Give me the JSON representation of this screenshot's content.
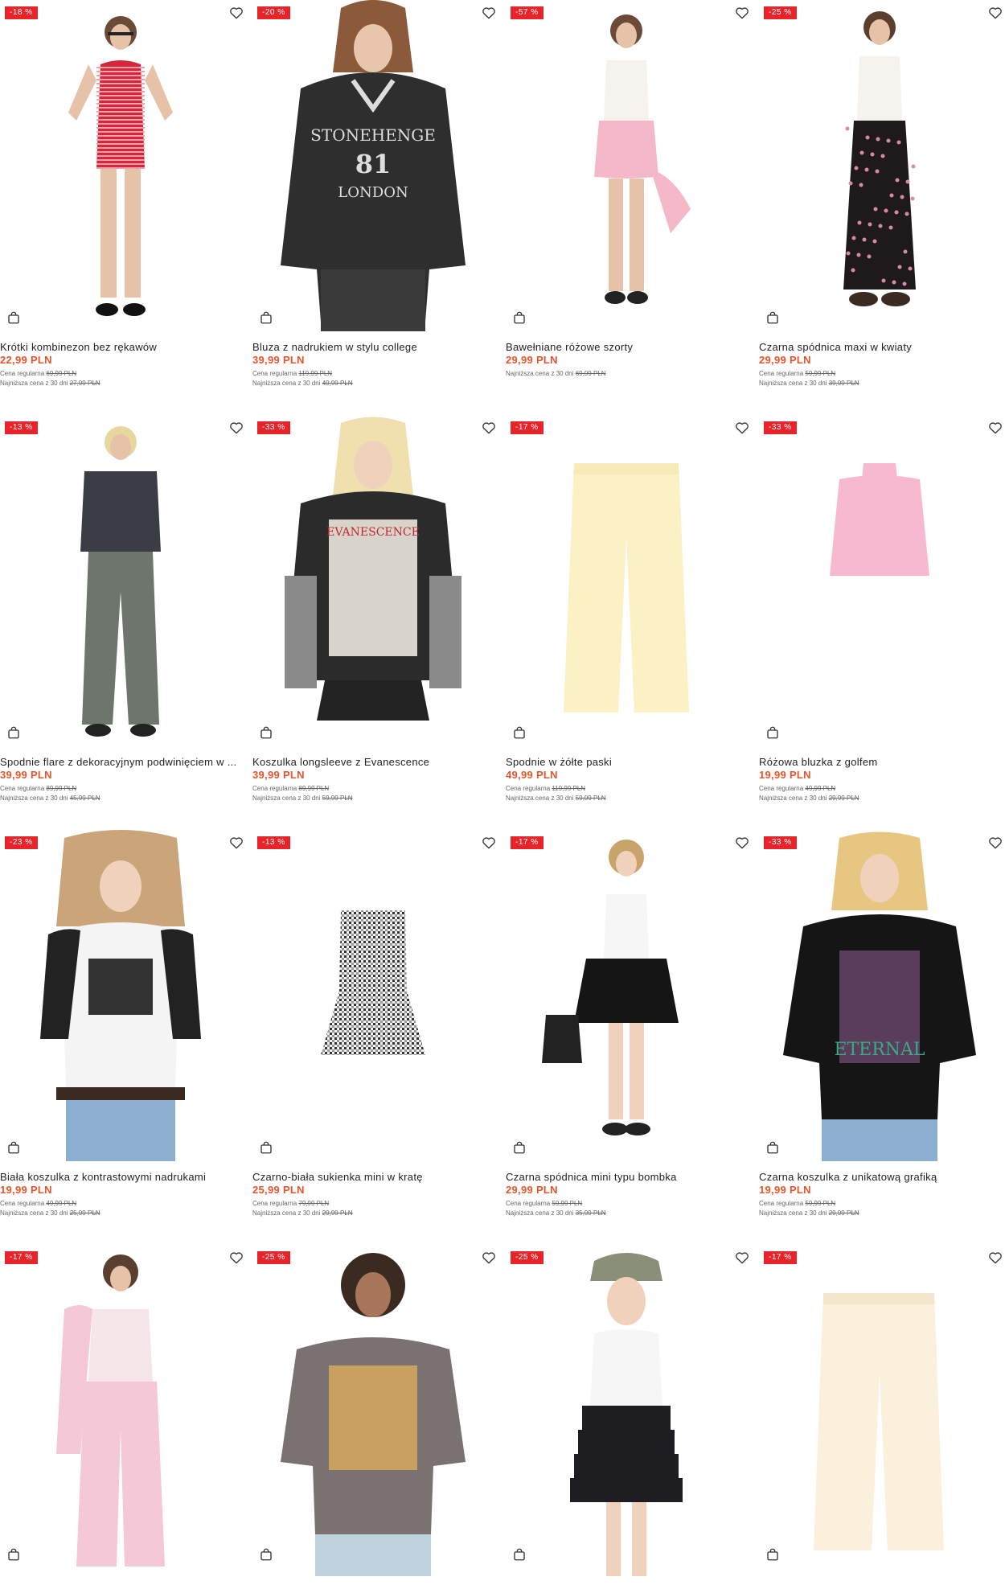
{
  "colors": {
    "discount_badge": "#e8242b",
    "sale_price": "#e8542b"
  },
  "icons": {
    "wishlist": "heart-icon",
    "cart": "shopping-bag-icon"
  },
  "products": [
    {
      "badge": "-18 %",
      "title": "Krótki kombinezon bez rękawów",
      "price": "22,99 PLN",
      "reg_label": "Cena regularna",
      "reg_price": "69,99 PLN",
      "low_label": "Najniższa cena z 30 dni",
      "low_price": "27,99 PLN"
    },
    {
      "badge": "-20 %",
      "title": "Bluza z nadrukiem w stylu college",
      "price": "39,99 PLN",
      "reg_label": "Cena regularna",
      "reg_price": "119,99 PLN",
      "low_label": "Najniższa cena z 30 dni",
      "low_price": "49,99 PLN"
    },
    {
      "badge": "-57 %",
      "title": "Bawełniane różowe szorty",
      "price": "29,99 PLN",
      "reg_label": "",
      "reg_price": "",
      "low_label": "Najniższa cena z 30 dni",
      "low_price": "69,99 PLN"
    },
    {
      "badge": "-25 %",
      "title": "Czarna spódnica maxi w kwiaty",
      "price": "29,99 PLN",
      "reg_label": "Cena regularna",
      "reg_price": "59,99 PLN",
      "low_label": "Najniższa cena z 30 dni",
      "low_price": "39,99 PLN"
    },
    {
      "badge": "-13 %",
      "title": "Spodnie flare z dekoracyjnym podwinięciem w ...",
      "price": "39,99 PLN",
      "reg_label": "Cena regularna",
      "reg_price": "89,99 PLN",
      "low_label": "Najniższa cena z 30 dni",
      "low_price": "45,99 PLN"
    },
    {
      "badge": "-33 %",
      "title": "Koszulka longsleeve z Evanescence",
      "price": "39,99 PLN",
      "reg_label": "Cena regularna",
      "reg_price": "89,99 PLN",
      "low_label": "Najniższa cena z 30 dni",
      "low_price": "59,99 PLN"
    },
    {
      "badge": "-17 %",
      "title": "Spodnie w żółte paski",
      "price": "49,99 PLN",
      "reg_label": "Cena regularna",
      "reg_price": "119,99 PLN",
      "low_label": "Najniższa cena z 30 dni",
      "low_price": "59,99 PLN"
    },
    {
      "badge": "-33 %",
      "title": "Różowa bluzka z golfem",
      "price": "19,99 PLN",
      "reg_label": "Cena regularna",
      "reg_price": "49,99 PLN",
      "low_label": "Najniższa cena z 30 dni",
      "low_price": "29,99 PLN"
    },
    {
      "badge": "-23 %",
      "title": "Biała koszulka z kontrastowymi nadrukami",
      "price": "19,99 PLN",
      "reg_label": "Cena regularna",
      "reg_price": "49,99 PLN",
      "low_label": "Najniższa cena z 30 dni",
      "low_price": "25,99 PLN"
    },
    {
      "badge": "-13 %",
      "title": "Czarno-biała sukienka mini w kratę",
      "price": "25,99 PLN",
      "reg_label": "Cena regularna",
      "reg_price": "79,99 PLN",
      "low_label": "Najniższa cena z 30 dni",
      "low_price": "29,99 PLN"
    },
    {
      "badge": "-17 %",
      "title": "Czarna spódnica mini typu bombka",
      "price": "29,99 PLN",
      "reg_label": "Cena regularna",
      "reg_price": "59,99 PLN",
      "low_label": "Najniższa cena z 30 dni",
      "low_price": "35,99 PLN"
    },
    {
      "badge": "-33 %",
      "title": "Czarna koszulka z unikatową grafiką",
      "price": "19,99 PLN",
      "reg_label": "Cena regularna",
      "reg_price": "59,99 PLN",
      "low_label": "Najniższa cena z 30 dni",
      "low_price": "29,99 PLN"
    },
    {
      "badge": "-17 %",
      "title": "",
      "price": "",
      "reg_label": "",
      "reg_price": "",
      "low_label": "",
      "low_price": ""
    },
    {
      "badge": "-25 %",
      "title": "",
      "price": "",
      "reg_label": "",
      "reg_price": "",
      "low_label": "",
      "low_price": ""
    },
    {
      "badge": "-25 %",
      "title": "",
      "price": "",
      "reg_label": "",
      "reg_price": "",
      "low_label": "",
      "low_price": ""
    },
    {
      "badge": "-17 %",
      "title": "",
      "price": "",
      "reg_label": "",
      "reg_price": "",
      "low_label": "",
      "low_price": ""
    }
  ]
}
